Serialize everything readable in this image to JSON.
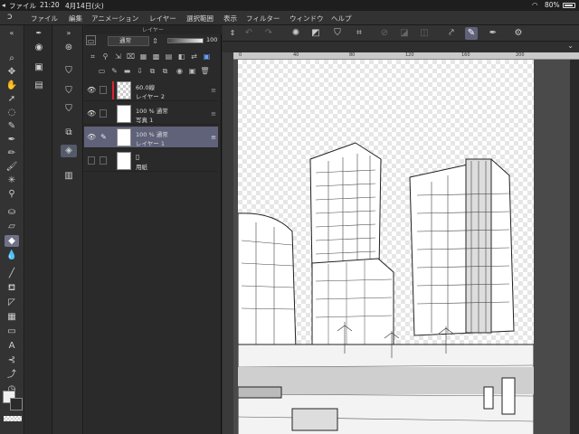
{
  "status_bar": {
    "app_name": "ファイル",
    "time": "21:20",
    "date": "4月14日(火)",
    "battery": "80%"
  },
  "menu": {
    "items": [
      "ファイル",
      "編集",
      "アニメーション",
      "レイヤー",
      "選択範囲",
      "表示",
      "フィルター",
      "ウィンドウ",
      "ヘルプ"
    ]
  },
  "layer_panel": {
    "title": "レイヤー",
    "blend_mode": "通常",
    "opacity": "100",
    "layers": [
      {
        "line1": "60.0線",
        "line2": "レイヤー 2",
        "visible": true,
        "selected": false
      },
      {
        "line1": "100 %  通常",
        "line2": "写真 1",
        "visible": true,
        "selected": false
      },
      {
        "line1": "100 %  通常",
        "line2": "レイヤー 1",
        "visible": true,
        "selected": true
      },
      {
        "line1": "",
        "line2": "用紙",
        "visible": false,
        "selected": false
      }
    ]
  },
  "ruler": {
    "ticks": [
      "0",
      "40",
      "80",
      "120",
      "160",
      "200"
    ]
  },
  "colors": {
    "accent": "#5f6279",
    "main_color": "#f0f0f0",
    "sub_color": "#2b2b2b"
  }
}
